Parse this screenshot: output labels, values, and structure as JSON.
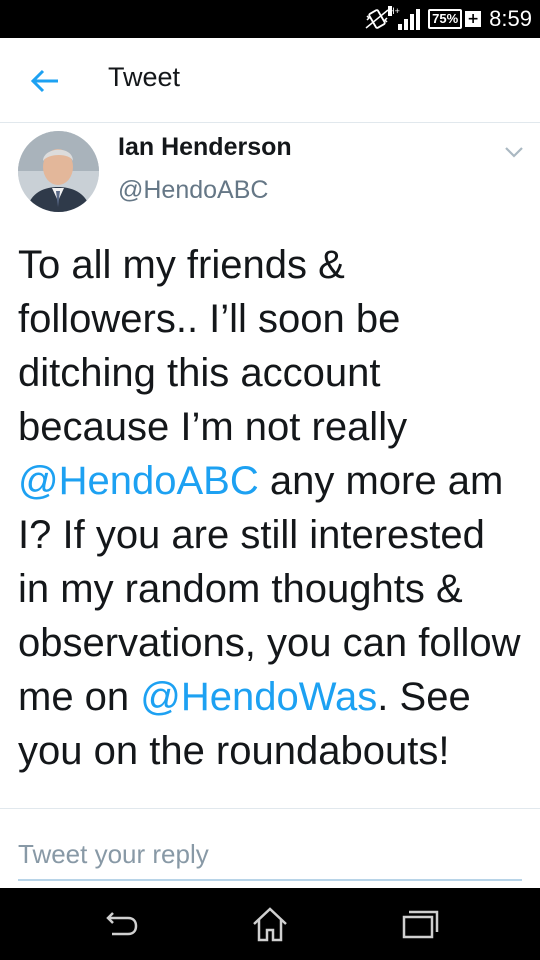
{
  "status_bar": {
    "network_label": "H+",
    "battery_percent": "75%",
    "battery_plus": "+",
    "time": "8:59"
  },
  "header": {
    "title": "Tweet"
  },
  "tweet": {
    "author_name": "Ian Henderson",
    "author_handle": "@HendoABC",
    "text_parts": {
      "p1": "To all my friends & followers.. I’ll soon be ditching this account because I’m not really ",
      "m1": "@HendoABC",
      "p2": " any more am I? If you are still interested in my random thoughts & observations, you can follow me on ",
      "m2": "@HendoWas",
      "p3": ". See you on the roundabouts!"
    }
  },
  "reply": {
    "placeholder": "Tweet your reply"
  },
  "icons": {
    "back": "arrow-left-icon",
    "more": "chevron-down-icon",
    "vibrate": "vibrate-icon",
    "signal": "signal-icon",
    "nav_back": "android-back-icon",
    "nav_home": "android-home-icon",
    "nav_recents": "android-recents-icon"
  },
  "colors": {
    "link": "#1da1f2",
    "text": "#14171a",
    "muted": "#657786",
    "status_bar": "#000000"
  }
}
